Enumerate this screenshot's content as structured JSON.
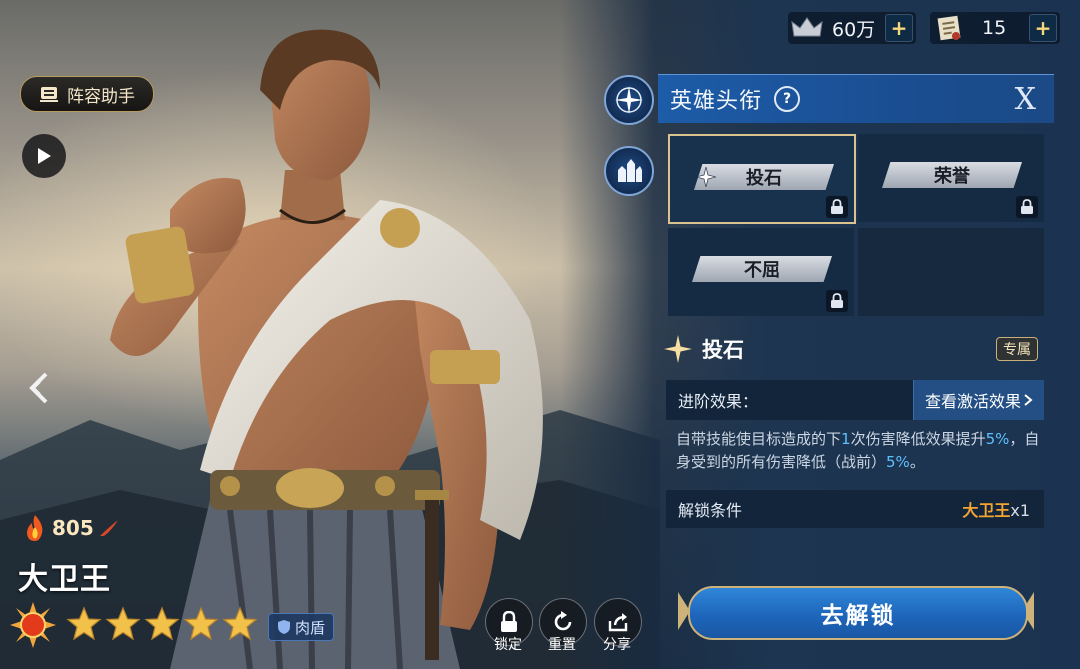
{
  "resources": [
    {
      "icon": "crown-resource-icon",
      "value": "60万"
    },
    {
      "icon": "scroll-resource-icon",
      "value": "15"
    }
  ],
  "left": {
    "assistant_label": "阵容助手",
    "power": "805",
    "hero_name": "大卫王",
    "stars": 5,
    "role": "肉盾"
  },
  "actions": [
    {
      "name": "lock",
      "label": "锁定"
    },
    {
      "name": "reset",
      "label": "重置"
    },
    {
      "name": "share",
      "label": "分享"
    }
  ],
  "panel": {
    "title": "英雄头衔",
    "help": "?",
    "close": "X",
    "titles": [
      {
        "label": "投石",
        "selected": true
      },
      {
        "label": "荣誉",
        "selected": false
      },
      {
        "label": "不屈",
        "selected": false
      }
    ],
    "skill": {
      "name": "投石",
      "tag": "专属",
      "effect_label": "进阶效果：",
      "view_effect": "查看激活效果",
      "desc_part1": "自带技能使目标造成的下",
      "desc_hl1": "1",
      "desc_part2": "次伤害降低效果提升",
      "desc_hl2": "5%",
      "desc_part3": "，自身受到的所有伤害降低（战前）",
      "desc_hl3": "5%",
      "desc_part4": "。",
      "unlock_label": "解锁条件",
      "unlock_hero": "大卫王",
      "unlock_count": "x1"
    },
    "unlock_button": "去解锁"
  },
  "colors": {
    "accent_blue": "#1d66bb",
    "gold": "#cdb27a",
    "highlight": "#5fc0ff",
    "req_orange": "#f3a431"
  }
}
